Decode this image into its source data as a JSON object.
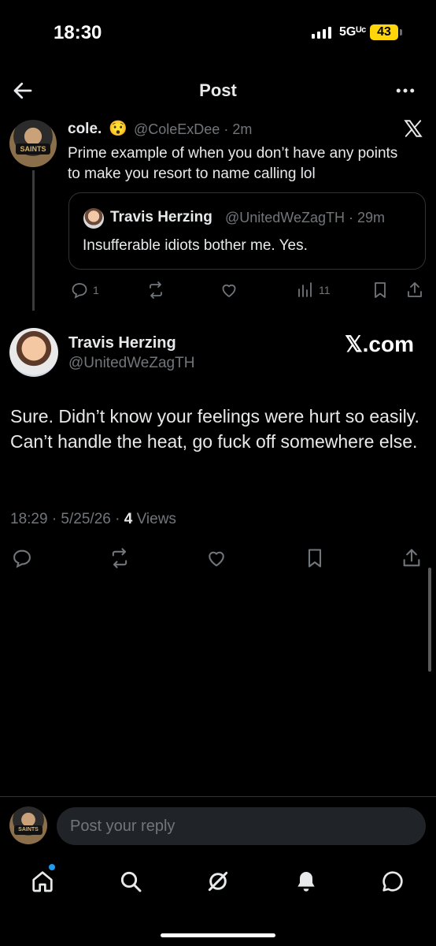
{
  "status_bar": {
    "time": "18:30",
    "network": "5Gᵁᶜ",
    "battery": "43"
  },
  "header": {
    "title": "Post"
  },
  "quoting_tweet": {
    "name": "cole.",
    "emoji": "😯",
    "handle_time": "@ColeExDee · 2m",
    "text": "Prime example of when you don’t have any points to make you resort to name calling lol",
    "quote": {
      "name": "Travis Herzing",
      "handle_time": "@UnitedWeZagTH · 29m",
      "text": "Insufferable idiots bother me. Yes."
    },
    "replies": "1",
    "views": "11"
  },
  "main_tweet": {
    "name": "Travis Herzing",
    "handle": "@UnitedWeZagTH",
    "watermark": "𝕏.com",
    "text": "Sure. Didn’t know your feelings were hurt so easily. Can’t handle the heat, go fuck off somewhere else.",
    "timestamp": "18:29 · 5/25/26 · ",
    "views_count": "4",
    "views_label": " Views"
  },
  "reply": {
    "placeholder": "Post your reply"
  },
  "nav": [
    "home-icon",
    "search-icon",
    "grok-icon",
    "notifications-icon",
    "messages-icon"
  ],
  "colors": {
    "background": "#000000",
    "text": "#e7e9ea",
    "muted": "#71767b",
    "accent": "#1d9bf0",
    "battery": "#ffd60a"
  }
}
